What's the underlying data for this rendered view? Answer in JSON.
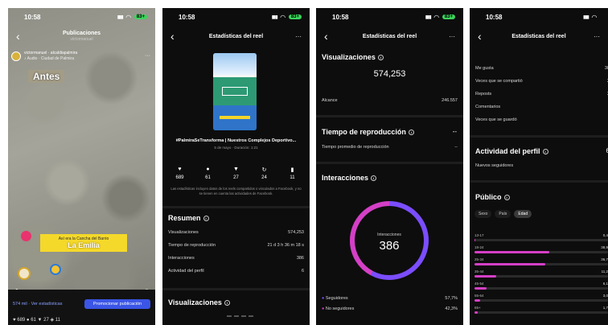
{
  "status": {
    "time": "10:58",
    "battery": "83+"
  },
  "panel1": {
    "nav_title": "Publicaciones",
    "nav_subtitle": "victormanuel",
    "author_line": "victormanuel · alcaldiapalmira",
    "audio_line": "♪ Audio · Ciudad de Palmira",
    "chip_text": "Antes",
    "banner_small": "Así era la Cancha del Barrio",
    "banner_big": "La Emilia",
    "views_link": "574 mil · Ver estadísticas",
    "promo_button": "Promocionar publicación",
    "actions": "♥ 689  ● 61  ▼ 27  ◈ 11"
  },
  "panel2": {
    "nav_title": "Estadísticas del reel",
    "post_title": "#PalmiraSeTransforma | Nuestros Complejos Deportivo...",
    "post_meta": "5 de mayo · Duración: 1:21",
    "stats": [
      {
        "icon": "heart-icon",
        "glyph": "♥",
        "value": "689"
      },
      {
        "icon": "comment-icon",
        "glyph": "●",
        "value": "61"
      },
      {
        "icon": "share-icon",
        "glyph": "▼",
        "value": "27"
      },
      {
        "icon": "repost-icon",
        "glyph": "↻",
        "value": "24"
      },
      {
        "icon": "save-icon",
        "glyph": "▮",
        "value": "11"
      }
    ],
    "disclaimer": "Las estadísticas incluyen datos de los reels compartidos o vinculados a Facebook, y no se tienen en cuenta las actividades de Facebook.",
    "summary_title": "Resumen",
    "summary_rows": [
      {
        "label": "Visualizaciones",
        "value": "574,253"
      },
      {
        "label": "Tiempo de reproducción",
        "value": "21 d 3 h 36 m 18 s"
      },
      {
        "label": "Interacciones",
        "value": "386"
      },
      {
        "label": "Actividad del perfil",
        "value": "6"
      }
    ],
    "views_title": "Visualizaciones"
  },
  "panel3": {
    "nav_title": "Estadísticas del reel",
    "views_title": "Visualizaciones",
    "views_total": "574,253",
    "reach_label": "Alcance",
    "reach_value": "246.557",
    "playback_title": "Tiempo de reproducción",
    "playback_dash": "--",
    "playback_avg_label": "Tiempo promedio de reproducción",
    "playback_avg_value": "--",
    "interactions_title": "Interacciones",
    "donut_label": "Interacciones",
    "donut_value": "386",
    "donut_split": {
      "followers": 0.577,
      "non_followers": 0.423
    },
    "legend": [
      {
        "label": "Seguidores",
        "value": "57,7%",
        "color": "#7b4dff"
      },
      {
        "label": "No seguidores",
        "value": "42,3%",
        "color": "#d43fc6"
      }
    ]
  },
  "panel4": {
    "nav_title": "Estadísticas del reel",
    "interaction_rows": [
      {
        "label": "Me gusta",
        "value": "30"
      },
      {
        "label": "Veces que se compartió",
        "value": "2"
      },
      {
        "label": "Reposts",
        "value": "2"
      },
      {
        "label": "Comentarios",
        "value": ""
      },
      {
        "label": "Veces que se guardó",
        "value": ""
      }
    ],
    "profile_title": "Actividad del perfil",
    "profile_dash": "6",
    "new_followers_label": "Nuevos seguidores",
    "public_title": "Público",
    "tabs": [
      "Sexo",
      "País",
      "Edad"
    ],
    "age_rows": [
      {
        "label": "13-17",
        "value": "0,4",
        "pct": 0.004
      },
      {
        "label": "18-24",
        "value": "38,9",
        "pct": 0.389
      },
      {
        "label": "25-34",
        "value": "36,7",
        "pct": 0.367
      },
      {
        "label": "35-44",
        "value": "11,2",
        "pct": 0.112
      },
      {
        "label": "45-54",
        "value": "6,1",
        "pct": 0.061
      },
      {
        "label": "55-64",
        "value": "3,0",
        "pct": 0.03
      },
      {
        "label": "65+",
        "value": "1,7",
        "pct": 0.017
      }
    ],
    "colors": {
      "bar": "#d43fc6"
    }
  }
}
